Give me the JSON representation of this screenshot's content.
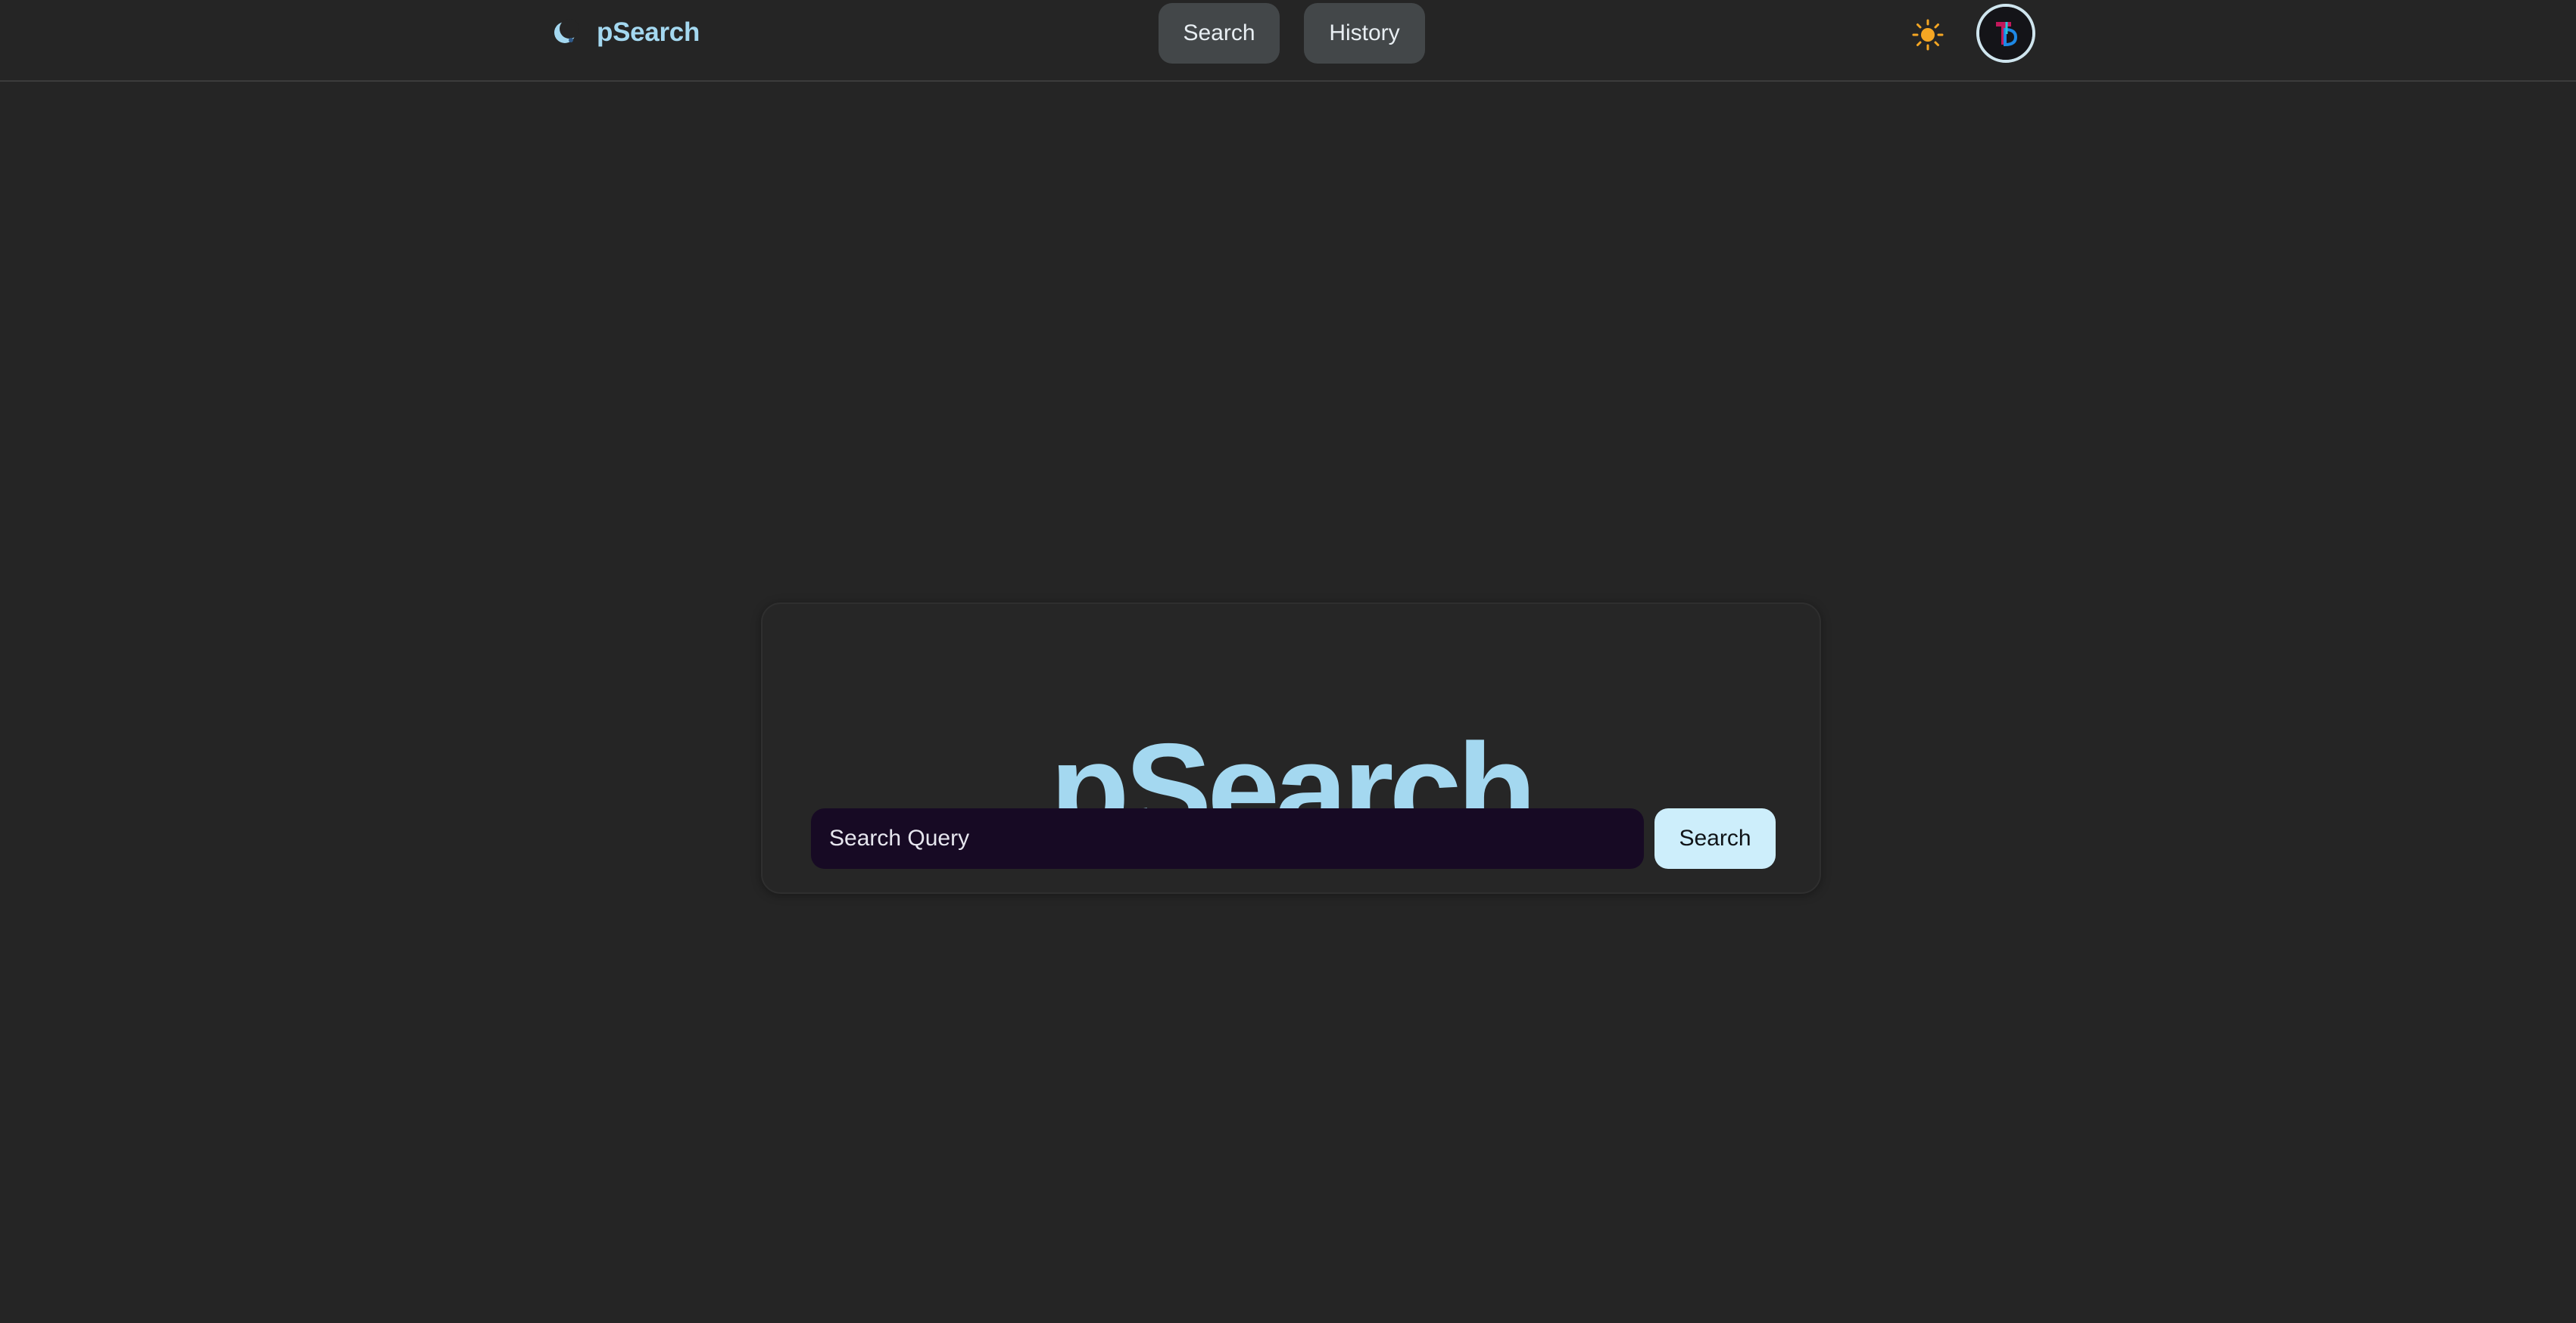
{
  "navbar": {
    "brand_name": "pSearch",
    "brand_icon": "moon-logo-icon",
    "nav_search_label": "Search",
    "nav_history_label": "History",
    "theme_icon": "sun-icon",
    "avatar_icon": "user-avatar-icon"
  },
  "main": {
    "title": "pSearch",
    "search_placeholder": "Search Query",
    "search_value": "",
    "search_button_label": "Search"
  },
  "colors": {
    "background": "#252525",
    "accent": "#a4d8f0",
    "nav_button": "#434749",
    "input_background": "#170a24",
    "search_button": "#cdeefb",
    "sun": "#f5a623"
  }
}
